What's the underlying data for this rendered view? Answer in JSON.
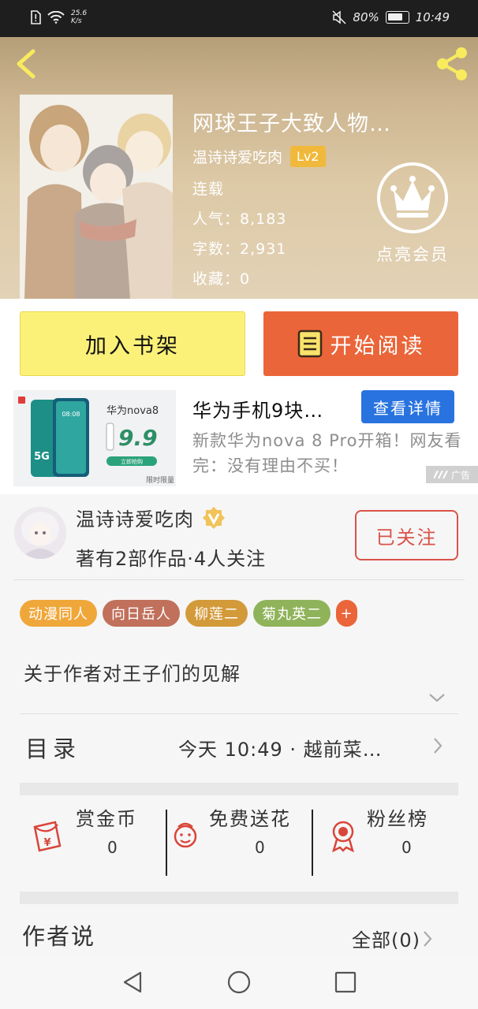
{
  "status_bar": {
    "net_speed_value": "25.6",
    "net_speed_unit": "K/s",
    "battery": "80%",
    "time": "10:49"
  },
  "book": {
    "title": "网球王子大致人物…",
    "author": "温诗诗爱吃肉",
    "level": "Lv2",
    "status": "连载",
    "popularity": "人气：8,183",
    "word_count": "字数：2,931",
    "favorites": "收藏：0"
  },
  "vip": {
    "label": "点亮会员"
  },
  "actions": {
    "add_shelf": "加入书架",
    "start_reading": "开始阅读"
  },
  "ad": {
    "title": "华为手机9块…",
    "button": "查看详情",
    "description": "新款华为nova 8 Pro开箱！网友看完：没有理由不买！",
    "tag": "广告",
    "image_brand": "华为nova8",
    "image_price": "9.9",
    "image_5g": "5G",
    "image_buy": "立即抢购",
    "image_limited": "限时限量",
    "image_clock": "08:08"
  },
  "author_card": {
    "name": "温诗诗爱吃肉",
    "stats": "著有2部作品·4人关注",
    "follow_button": "已关注"
  },
  "tags": [
    {
      "label": "动漫同人",
      "color": "#f0a73a"
    },
    {
      "label": "向日岳人",
      "color": "#c0705b"
    },
    {
      "label": "柳莲二",
      "color": "#d39a3a"
    },
    {
      "label": "菊丸英二",
      "color": "#8fb35a"
    },
    {
      "label": "+",
      "color": "#ea6539"
    }
  ],
  "description": "关于作者对王子们的见解",
  "toc": {
    "label": "目录",
    "latest": "今天 10:49 · 越前菜…"
  },
  "support": {
    "reward": {
      "label": "赏金币",
      "value": "0"
    },
    "flower": {
      "label": "免费送花",
      "value": "0"
    },
    "fans": {
      "label": "粉丝榜",
      "value": "0"
    }
  },
  "author_says": {
    "label": "作者说",
    "all": "全部(0)"
  },
  "colors": {
    "accent": "#ea6539",
    "shelf_button": "#fbf179",
    "ad_button": "#2973e0",
    "icon_red": "#d9453a"
  }
}
